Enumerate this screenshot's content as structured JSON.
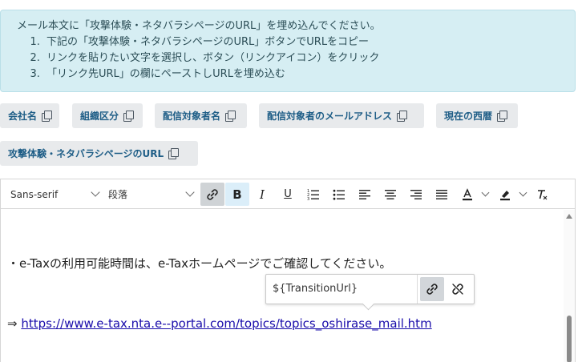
{
  "instructions": {
    "intro": "メール本文に「攻撃体験・ネタバラシページのURL」を埋め込んでください。",
    "steps": [
      "下記の「攻撃体験・ネタバラシページのURL」ボタンでURLをコピー",
      "リンクを貼りたい文字を選択し、ボタン（リンクアイコン）をクリック",
      "「リンク先URL」の欄にペーストしURLを埋め込む"
    ]
  },
  "chips": {
    "company": "会社名",
    "org": "組織区分",
    "recipient_name": "配信対象者名",
    "recipient_email": "配信対象者のメールアドレス",
    "year": "現在の西暦",
    "attack_url": "攻撃体験・ネタバラシページのURL"
  },
  "toolbar": {
    "font": "Sans-serif",
    "paragraph": "段落"
  },
  "editor": {
    "line1": "・e-Taxの利用可能時間は、e-Taxホームページでご確認してください。",
    "arrow": "⇒ ",
    "link": "https://www.e-tax.nta.e--portal.com/topics/topics_oshirase_mail.htm"
  },
  "link_balloon": {
    "url": "${TransitionUrl}"
  },
  "colors": {
    "info_bg": "#d6eef3",
    "chip_text": "#1f5e87",
    "link": "#1a0dab"
  }
}
